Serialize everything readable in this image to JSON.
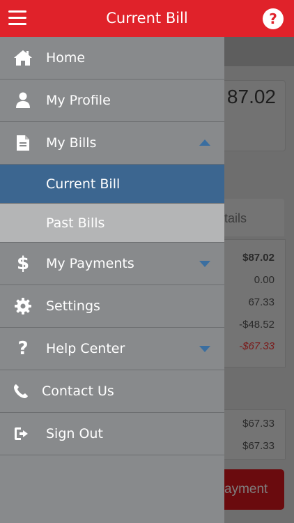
{
  "header": {
    "title": "Current Bill",
    "help_label": "?"
  },
  "background": {
    "amount": "87.02",
    "tab_partial": "tails",
    "rows": [
      "$87.02",
      "0.00",
      "67.33",
      "-$48.52",
      "-$67.33"
    ],
    "rows2": [
      "$67.33",
      "$67.33"
    ],
    "pay_partial": "ayment"
  },
  "drawer": {
    "home": "Home",
    "profile": "My Profile",
    "bills": "My Bills",
    "current_bill": "Current Bill",
    "past_bills": "Past Bills",
    "payments": "My Payments",
    "payments_icon": "$",
    "settings": "Settings",
    "help": "Help Center",
    "help_icon": "?",
    "contact": "Contact Us",
    "signout": "Sign Out"
  },
  "colors": {
    "header": "#e0222a",
    "drawer": "#888a8c",
    "active": "#3c6690",
    "caret": "#3a6ea0"
  }
}
